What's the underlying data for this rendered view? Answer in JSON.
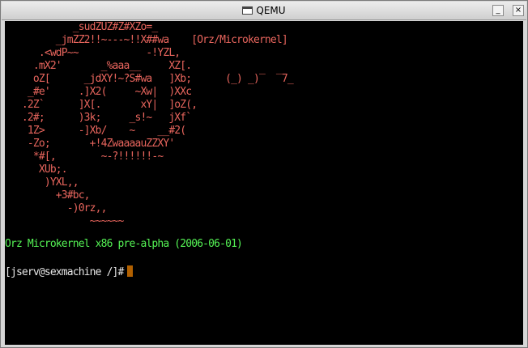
{
  "window": {
    "title": "QEMU",
    "minimize_glyph": "_",
    "close_glyph": "×"
  },
  "console": {
    "logo_lines": [
      "            _sudZUZ#Z#XZo=_",
      "         _jmZZ2!!~---~!!X##wa    [Orz/Microkernel]",
      "      .<wdP~~            -!YZL,",
      "     .mX2'       _%aaa__     XZ[.",
      "     oZ[      _jdXY!~?S#wa   ]Xb;      (_) _)‾  ‾7_",
      "    _#e'     .]X2(     ~Xw|  )XXc",
      "   .2Z`      ]X[.       xY|  ]oZ(,",
      "   .2#;      )3k;     _s!~   jXf`",
      "    1Z>      -]Xb/    ~    __#2(",
      "    -Zo;       +!4ZwaaaauZZXY'",
      "     *#[,        ~-?!!!!!!-~",
      "      XUb;.",
      "       )YXL,,",
      "         +3#bc,",
      "           -)0rz,,",
      "               ~~~~~~"
    ],
    "banner": "Orz Microkernel x86 pre-alpha (2006-06-01)",
    "prompt": "[jserv@sexmachine /]#"
  },
  "colors": {
    "logo": "#e8655d",
    "banner": "#55f455",
    "prompt": "#e8e8e8",
    "cursor": "#b16000",
    "screen_bg": "#000000"
  }
}
